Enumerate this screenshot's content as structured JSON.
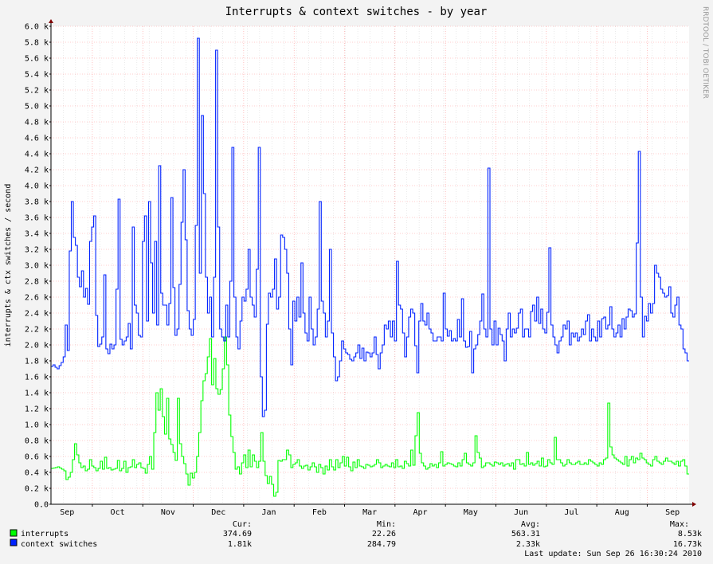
{
  "chart_data": {
    "type": "line",
    "title": "Interrupts & context switches - by year",
    "ylabel": "interrupts & ctx switches / second",
    "xlabel": "",
    "ylim": [
      0,
      6000
    ],
    "yticks": [
      "0.0",
      "0.2 k",
      "0.4 k",
      "0.6 k",
      "0.8 k",
      "1.0 k",
      "1.2 k",
      "1.4 k",
      "1.6 k",
      "1.8 k",
      "2.0 k",
      "2.2 k",
      "2.4 k",
      "2.6 k",
      "2.8 k",
      "3.0 k",
      "3.2 k",
      "3.4 k",
      "3.6 k",
      "3.8 k",
      "4.0 k",
      "4.2 k",
      "4.4 k",
      "4.6 k",
      "4.8 k",
      "5.0 k",
      "5.2 k",
      "5.4 k",
      "5.6 k",
      "5.8 k",
      "6.0 k"
    ],
    "month_labels": [
      "Sep",
      "Oct",
      "Nov",
      "Dec",
      "Jan",
      "Feb",
      "Mar",
      "Apr",
      "May",
      "Jun",
      "Jul",
      "Aug",
      "Sep"
    ],
    "grid": true,
    "series": [
      {
        "name": "interrupts",
        "color": "#00ff00",
        "values": [
          450,
          455,
          460,
          470,
          455,
          440,
          420,
          310,
          340,
          400,
          560,
          760,
          620,
          520,
          460,
          480,
          420,
          440,
          560,
          480,
          460,
          420,
          450,
          540,
          440,
          590,
          450,
          460,
          430,
          440,
          450,
          550,
          420,
          450,
          540,
          400,
          460,
          470,
          560,
          460,
          500,
          520,
          460,
          450,
          390,
          500,
          600,
          440,
          900,
          1400,
          1180,
          1450,
          1100,
          880,
          1330,
          820,
          750,
          650,
          550,
          1330,
          760,
          600,
          510,
          380,
          240,
          390,
          330,
          400,
          600,
          900,
          1300,
          1550,
          1640,
          1850,
          2080,
          1500,
          1830,
          1450,
          1380,
          1440,
          1700,
          2100,
          1750,
          1120,
          850,
          650,
          440,
          470,
          380,
          520,
          620,
          460,
          680,
          470,
          620,
          540,
          460,
          540,
          900,
          540,
          360,
          260,
          350,
          250,
          100,
          150,
          550,
          540,
          560,
          560,
          680,
          620,
          460,
          500,
          520,
          560,
          480,
          450,
          480,
          490,
          430,
          470,
          520,
          470,
          400,
          500,
          460,
          380,
          480,
          430,
          560,
          470,
          430,
          560,
          460,
          520,
          600,
          480,
          590,
          470,
          420,
          530,
          460,
          560,
          480,
          470,
          450,
          500,
          490,
          470,
          480,
          500,
          560,
          520,
          460,
          480,
          500,
          480,
          470,
          520,
          460,
          560,
          470,
          480,
          450,
          540,
          510,
          480,
          680,
          490,
          860,
          1150,
          640,
          520,
          480,
          440,
          460,
          510,
          480,
          500,
          460,
          520,
          660,
          480,
          500,
          520,
          510,
          500,
          480,
          470,
          520,
          480,
          560,
          640,
          520,
          500,
          480,
          520,
          860,
          650,
          580,
          460,
          480,
          520,
          520,
          500,
          480,
          530,
          520,
          500,
          520,
          480,
          500,
          510,
          480,
          520,
          440,
          560,
          560,
          500,
          510,
          480,
          650,
          500,
          520,
          490,
          510,
          540,
          480,
          580,
          470,
          480,
          560,
          520,
          500,
          840,
          560,
          560,
          520,
          480,
          500,
          560,
          520,
          500,
          500,
          520,
          540,
          500,
          500,
          520,
          500,
          560,
          540,
          520,
          500,
          480,
          520,
          500,
          560,
          580,
          1270,
          720,
          620,
          580,
          560,
          540,
          520,
          500,
          600,
          480,
          560,
          600,
          520,
          580,
          560,
          640,
          580,
          560,
          520,
          500,
          480,
          560,
          600,
          540,
          520,
          500,
          540,
          580,
          540,
          540,
          520,
          500,
          540,
          480,
          540,
          560,
          480,
          380
        ]
      },
      {
        "name": "context switches",
        "color": "#0022ff",
        "values": [
          1730,
          1750,
          1720,
          1700,
          1740,
          1780,
          1850,
          2250,
          1930,
          3180,
          3800,
          3350,
          3250,
          2850,
          2730,
          2930,
          2600,
          2710,
          2510,
          3300,
          3480,
          3620,
          2370,
          1980,
          2010,
          2100,
          2880,
          1950,
          1890,
          2010,
          1950,
          2000,
          2700,
          3830,
          2070,
          2000,
          2050,
          2100,
          2270,
          1950,
          3480,
          2500,
          2400,
          2120,
          2100,
          3300,
          3620,
          2300,
          3800,
          3030,
          2400,
          3300,
          2250,
          4250,
          2650,
          2500,
          2500,
          2250,
          2520,
          3850,
          2720,
          2120,
          2200,
          2760,
          3540,
          4200,
          3320,
          2430,
          2200,
          2120,
          2320,
          3500,
          5850,
          2900,
          4880,
          3900,
          2850,
          2400,
          2600,
          2100,
          2850,
          5700,
          3480,
          2200,
          2100,
          2050,
          2500,
          2100,
          2800,
          4480,
          2600,
          2100,
          1950,
          2300,
          2600,
          2550,
          2700,
          3200,
          2600,
          2500,
          2350,
          2950,
          4480,
          1600,
          1100,
          1180,
          2260,
          2650,
          2600,
          2700,
          3080,
          2450,
          2600,
          3380,
          3350,
          3200,
          2900,
          2200,
          1750,
          2550,
          2300,
          2600,
          2350,
          3030,
          2400,
          2150,
          2050,
          2600,
          2200,
          2000,
          2100,
          2450,
          3800,
          2550,
          2400,
          2100,
          2300,
          3200,
          2150,
          1850,
          1550,
          1600,
          1800,
          2050,
          1950,
          1900,
          1880,
          1820,
          1800,
          1850,
          1900,
          2000,
          1830,
          1960,
          1800,
          1910,
          1900,
          1850,
          1900,
          2100,
          1880,
          1700,
          1900,
          2000,
          2250,
          2200,
          2300,
          2100,
          2300,
          2050,
          3050,
          2500,
          2450,
          2150,
          1850,
          2100,
          2350,
          2450,
          2400,
          1990,
          1650,
          2300,
          2520,
          2300,
          2250,
          2400,
          2200,
          2150,
          2050,
          2050,
          2100,
          2100,
          2050,
          2650,
          2200,
          2110,
          2180,
          2050,
          2080,
          2050,
          2320,
          2100,
          2580,
          2050,
          1970,
          1980,
          2170,
          1650,
          1950,
          2000,
          2130,
          2300,
          2640,
          2200,
          2100,
          4220,
          2200,
          2000,
          2300,
          2000,
          2210,
          2130,
          2050,
          1800,
          2200,
          2400,
          2100,
          2200,
          2150,
          2210,
          2400,
          2450,
          2100,
          2200,
          2200,
          2100,
          2420,
          2500,
          2300,
          2600,
          2270,
          2450,
          2200,
          2150,
          2410,
          3220,
          2250,
          2100,
          2000,
          1900,
          2050,
          2100,
          2250,
          2200,
          2300,
          2000,
          2150,
          2100,
          2150,
          2050,
          2100,
          2200,
          2130,
          2300,
          2380,
          2050,
          2200,
          2100,
          2050,
          2300,
          2100,
          2330,
          2350,
          2200,
          2250,
          2480,
          2200,
          2100,
          2150,
          2250,
          2100,
          2330,
          2200,
          2350,
          2450,
          2430,
          2350,
          2390,
          3280,
          4430,
          2600,
          2100,
          2360,
          2300,
          2520,
          2400,
          2520,
          3000,
          2900,
          2850,
          2700,
          2650,
          2600,
          2620,
          2730,
          2400,
          2350,
          2500,
          2600,
          2250,
          2200,
          1950,
          1900,
          1800
        ]
      }
    ]
  },
  "legend": {
    "header_cur": "Cur:",
    "header_min": "Min:",
    "header_avg": "Avg:",
    "header_max": "Max:",
    "rows": [
      {
        "label": "interrupts",
        "color": "#00ff00",
        "cur": "374.69",
        "min": "22.26",
        "avg": "563.31",
        "max": "8.53k"
      },
      {
        "label": "context switches",
        "color": "#0022ff",
        "cur": "1.81k",
        "min": "284.79",
        "avg": "2.33k",
        "max": "16.73k"
      }
    ]
  },
  "last_update": "Last update: Sun Sep 26 16:30:24 2010",
  "watermark": "RRDTOOL / TOBI OETIKER"
}
